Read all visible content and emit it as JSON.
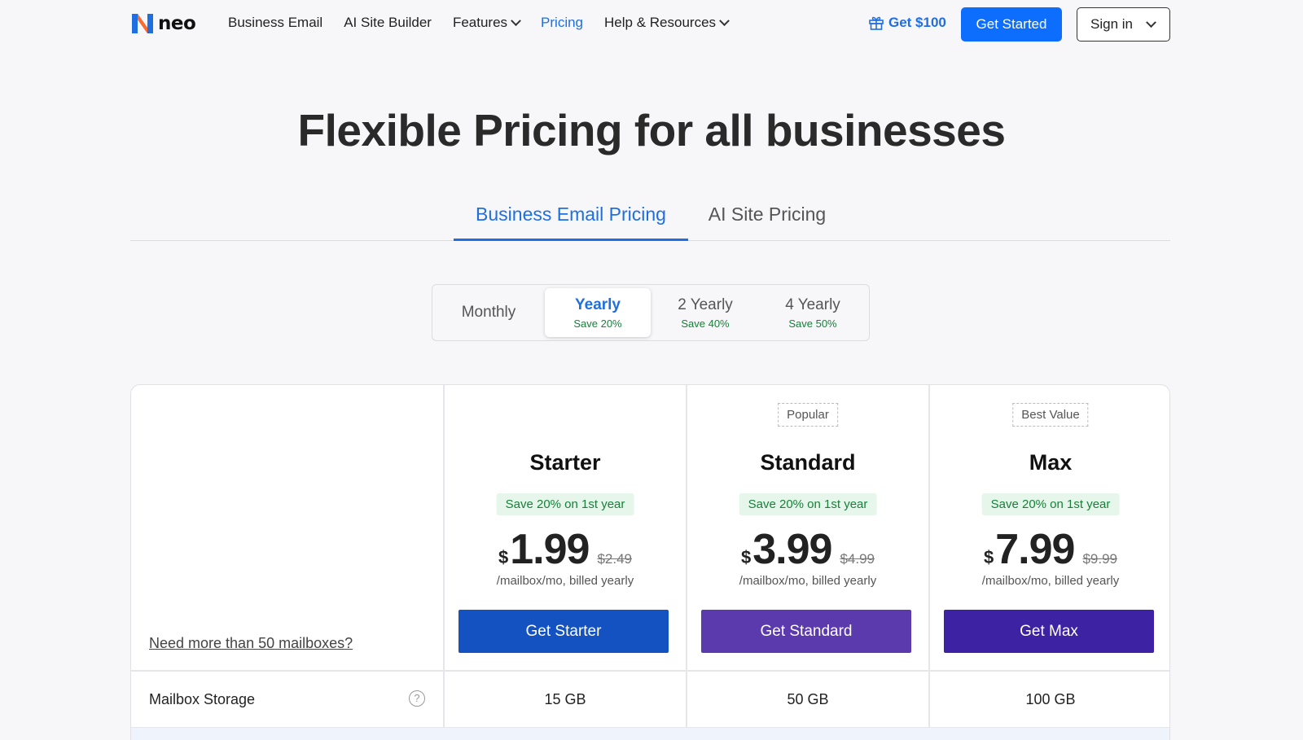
{
  "brand": {
    "name": "neo"
  },
  "nav": {
    "links": [
      {
        "label": "Business Email",
        "dropdown": false
      },
      {
        "label": "AI Site Builder",
        "dropdown": false
      },
      {
        "label": "Features",
        "dropdown": true
      },
      {
        "label": "Pricing",
        "dropdown": false,
        "active": true
      },
      {
        "label": "Help & Resources",
        "dropdown": true
      }
    ],
    "promo_label": "Get $100",
    "get_started_label": "Get Started",
    "sign_in_label": "Sign in"
  },
  "hero": {
    "title": "Flexible Pricing for all businesses"
  },
  "tabs": [
    {
      "label": "Business Email Pricing",
      "active": true
    },
    {
      "label": "AI Site Pricing",
      "active": false
    }
  ],
  "billing": [
    {
      "label": "Monthly",
      "save": ""
    },
    {
      "label": "Yearly",
      "save": "Save 20%",
      "active": true
    },
    {
      "label": "2 Yearly",
      "save": "Save 40%"
    },
    {
      "label": "4 Yearly",
      "save": "Save 50%"
    }
  ],
  "pricing": {
    "more_link": "Need more than 50 mailboxes?",
    "plans": [
      {
        "badge": "",
        "name": "Starter",
        "save": "Save 20% on 1st year",
        "currency": "$",
        "price": "1.99",
        "old_price": "$2.49",
        "unit": "/mailbox/mo, billed yearly",
        "cta": "Get Starter",
        "color": "#1452c2"
      },
      {
        "badge": "Popular",
        "name": "Standard",
        "save": "Save 20% on 1st year",
        "currency": "$",
        "price": "3.99",
        "old_price": "$4.99",
        "unit": "/mailbox/mo, billed yearly",
        "cta": "Get Standard",
        "color": "#5b3aae"
      },
      {
        "badge": "Best Value",
        "name": "Max",
        "save": "Save 20% on 1st year",
        "currency": "$",
        "price": "7.99",
        "old_price": "$9.99",
        "unit": "/mailbox/mo, billed yearly",
        "cta": "Get Max",
        "color": "#3d23a3"
      }
    ],
    "features": [
      {
        "label": "Mailbox Storage",
        "values": [
          "15 GB",
          "50 GB",
          "100 GB"
        ]
      }
    ]
  },
  "colors": {
    "accent": "#1f6fe0",
    "primary_button": "#0d6efd",
    "save_green": "#16803a"
  }
}
